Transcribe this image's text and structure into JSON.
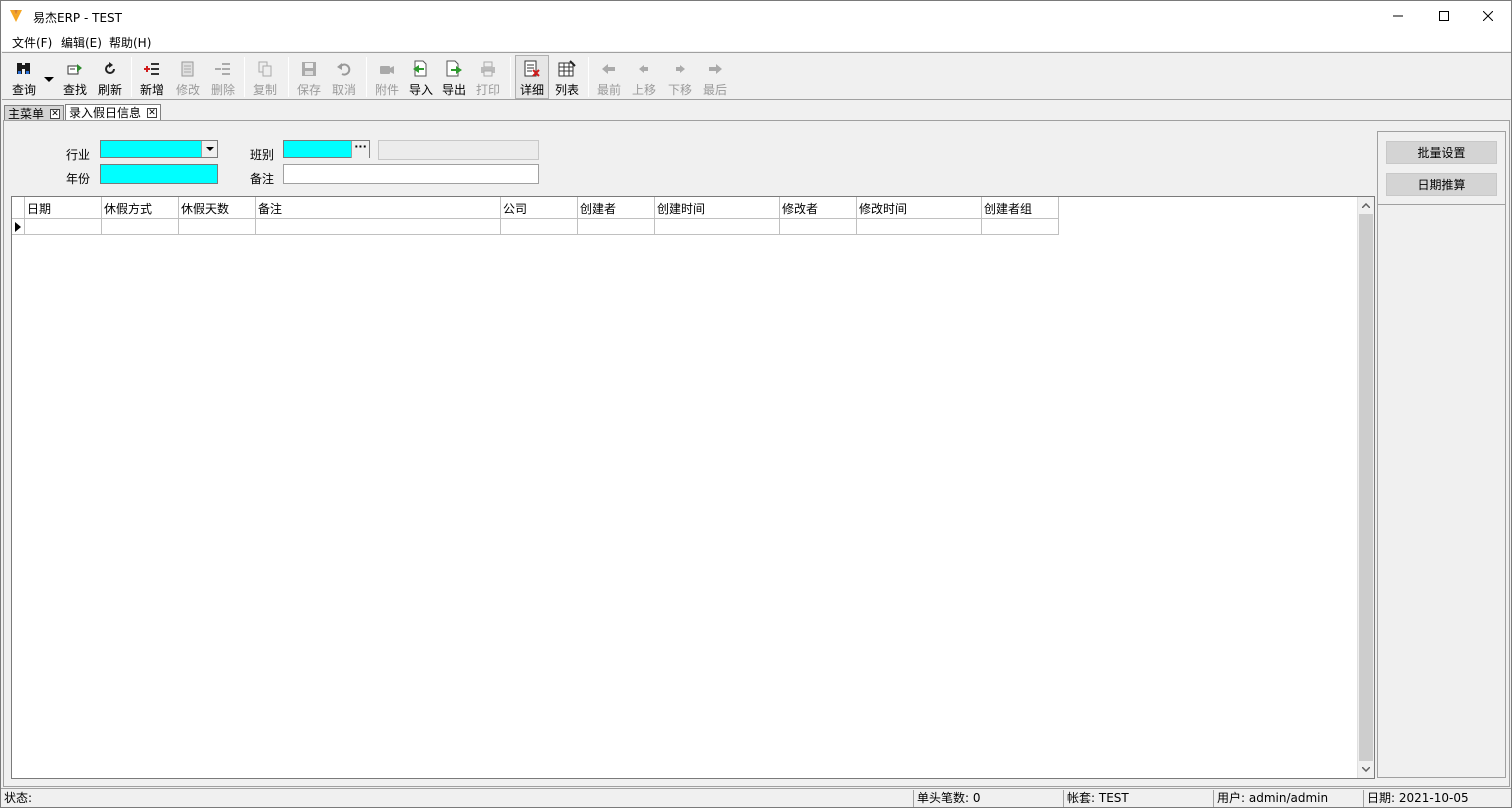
{
  "window": {
    "title": "易杰ERP - TEST"
  },
  "menu": {
    "items": [
      "文件(F)",
      "编辑(E)",
      "帮助(H)"
    ]
  },
  "toolbar": {
    "query": "查询",
    "find": "查找",
    "refresh": "刷新",
    "add": "新增",
    "edit": "修改",
    "delete": "删除",
    "copy": "复制",
    "save": "保存",
    "cancel": "取消",
    "attach": "附件",
    "import": "导入",
    "export": "导出",
    "print": "打印",
    "detail": "详细",
    "list": "列表",
    "first": "最前",
    "prev": "上移",
    "next": "下移",
    "last": "最后"
  },
  "tabs": [
    {
      "label": "主菜单"
    },
    {
      "label": "录入假日信息"
    }
  ],
  "form": {
    "industry_label": "行业",
    "year_label": "年份",
    "shift_label": "班别",
    "remark_label": "备注",
    "industry_value": "",
    "year_value": "",
    "shift_value": "",
    "remark_value": ""
  },
  "grid": {
    "columns": [
      "日期",
      "休假方式",
      "休假天数",
      "备注",
      "公司",
      "创建者",
      "创建时间",
      "修改者",
      "修改时间",
      "创建者组"
    ]
  },
  "side": {
    "batch_set": "批量设置",
    "date_calc": "日期推算"
  },
  "status": {
    "state": "状态:",
    "count": "单头笔数: 0",
    "account": "帐套: TEST",
    "user": "用户: admin/admin",
    "date": "日期: 2021-10-05"
  },
  "colors": {
    "required_field": "#00ffff",
    "logo": "#f5a623"
  }
}
